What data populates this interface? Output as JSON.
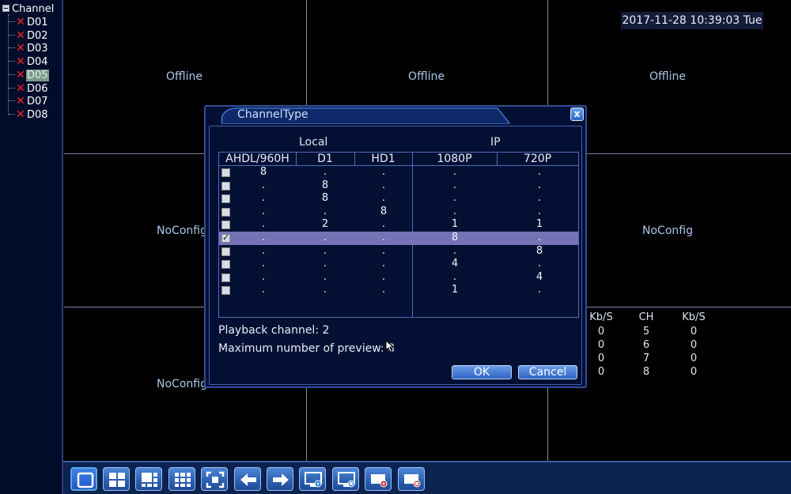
{
  "sidebar": {
    "root_label": "Channel",
    "channels": [
      {
        "label": "D01",
        "status": "disconnected"
      },
      {
        "label": "D02",
        "status": "disconnected"
      },
      {
        "label": "D03",
        "status": "disconnected"
      },
      {
        "label": "D04",
        "status": "disconnected"
      },
      {
        "label": "D05",
        "status": "disconnected"
      },
      {
        "label": "D06",
        "status": "disconnected"
      },
      {
        "label": "D07",
        "status": "disconnected"
      },
      {
        "label": "D08",
        "status": "disconnected"
      }
    ],
    "selected": "D05"
  },
  "header": {
    "datetime": "2017-11-28 10:39:03 Tue"
  },
  "grid": {
    "cells": [
      {
        "label": "Offline"
      },
      {
        "label": "Offline"
      },
      {
        "label": "Offline"
      },
      {
        "label": "NoConfig"
      },
      {
        "label": "NoConfig"
      },
      {
        "label": "NoConfig"
      }
    ]
  },
  "bitrate": {
    "headers": [
      "Kb/S",
      "CH",
      "Kb/S"
    ],
    "rows": [
      [
        "0",
        "5",
        "0"
      ],
      [
        "0",
        "6",
        "0"
      ],
      [
        "0",
        "7",
        "0"
      ],
      [
        "0",
        "8",
        "0"
      ]
    ]
  },
  "dialog": {
    "title": "ChannelType",
    "close_label": "x",
    "group_local": "Local",
    "group_ip": "IP",
    "columns": [
      "AHDL/960H",
      "D1",
      "HD1",
      "1080P",
      "720P"
    ],
    "rows": [
      {
        "checked": false,
        "values": [
          "8",
          ".",
          ".",
          ".",
          "."
        ]
      },
      {
        "checked": false,
        "values": [
          ".",
          "8",
          ".",
          ".",
          "."
        ]
      },
      {
        "checked": false,
        "values": [
          ".",
          "8",
          ".",
          ".",
          "."
        ]
      },
      {
        "checked": false,
        "values": [
          ".",
          ".",
          "8",
          ".",
          "."
        ]
      },
      {
        "checked": false,
        "values": [
          ".",
          "2",
          ".",
          "1",
          "1"
        ]
      },
      {
        "checked": true,
        "values": [
          ".",
          ".",
          ".",
          "8",
          "."
        ]
      },
      {
        "checked": false,
        "values": [
          ".",
          ".",
          ".",
          ".",
          "8"
        ]
      },
      {
        "checked": false,
        "values": [
          ".",
          ".",
          ".",
          "4",
          "."
        ]
      },
      {
        "checked": false,
        "values": [
          ".",
          ".",
          ".",
          ".",
          "4"
        ]
      },
      {
        "checked": false,
        "values": [
          ".",
          ".",
          ".",
          "1",
          "."
        ]
      }
    ],
    "selected_row": 5,
    "playback_text": "Playback channel: 2",
    "max_preview_text": "Maximum number of preview: 8",
    "ok_label": "OK",
    "cancel_label": "Cancel"
  },
  "taskbar": {
    "buttons": [
      "single-view-icon",
      "quad-view-icon",
      "six-view-icon",
      "nine-view-icon",
      "fullscreen-icon",
      "previous-icon",
      "next-icon",
      "playback-icon",
      "remote-device-icon",
      "record-icon",
      "stop-record-icon"
    ],
    "active_index": 0
  },
  "colors": {
    "accent": "#2e4f9a",
    "selected_row": "#7473b6",
    "disconnected": "#ff2020",
    "cell_text": "#a8c8e8"
  }
}
